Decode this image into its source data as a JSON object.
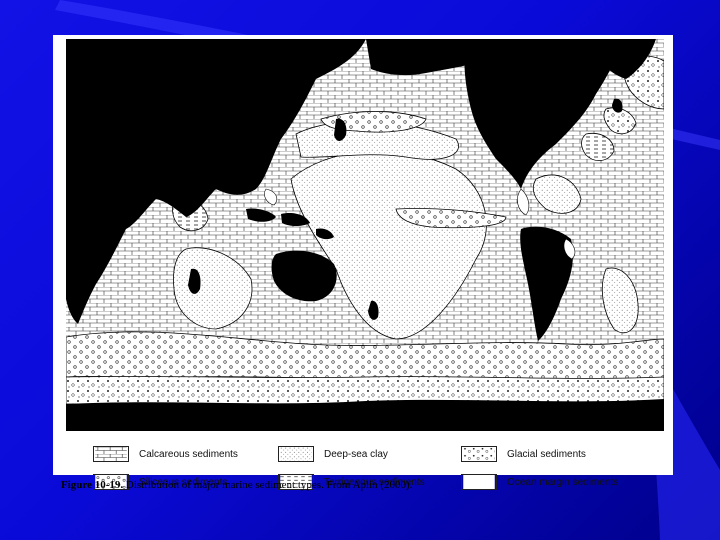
{
  "legend": {
    "items": [
      {
        "label": "Calcareous sediments",
        "pattern": "brick"
      },
      {
        "label": "Deep-sea clay",
        "pattern": "dots"
      },
      {
        "label": "Glacial sediments",
        "pattern": "glacial"
      },
      {
        "label": "Siliceous sediments",
        "pattern": "circles"
      },
      {
        "label": "Terrigenous sediments",
        "pattern": "dashes"
      },
      {
        "label": "Ocean margin sediments",
        "pattern": "blank"
      }
    ]
  },
  "caption": {
    "label": "Figure 10-19.",
    "text": " Distribution of major marine sediment types. From Aplin (2000)."
  },
  "colors": {
    "background": "#0a0ad8",
    "land": "#000000",
    "paper": "#ffffff"
  }
}
